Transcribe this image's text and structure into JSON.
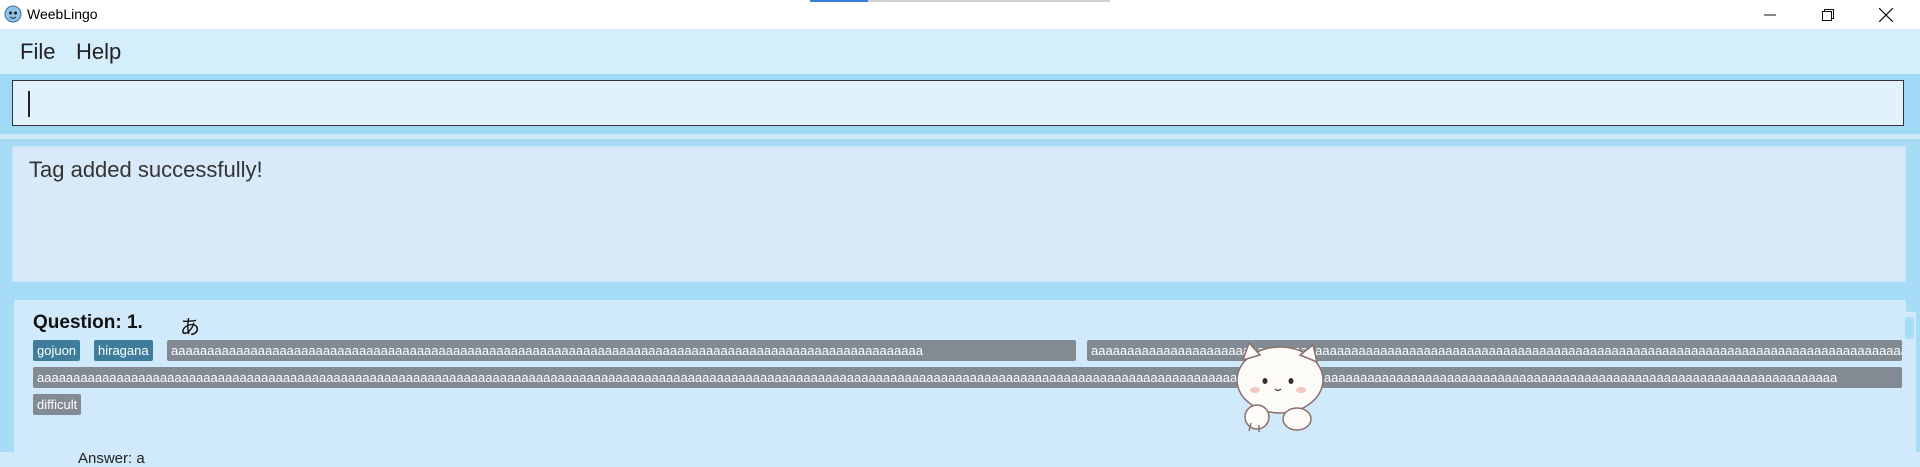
{
  "window": {
    "title": "WeebLingo"
  },
  "menu": {
    "items": [
      "File",
      "Help"
    ]
  },
  "command": {
    "value": ""
  },
  "result": {
    "message": "Tag added successfully!"
  },
  "question": {
    "label": "Question: 1.",
    "kana": "あ",
    "tags": [
      {
        "text": "gojuon",
        "kind": "category"
      },
      {
        "text": "hiragana",
        "kind": "category"
      },
      {
        "text": "aaaaaaaaaaaaaaaaaaaaaaaaaaaaaaaaaaaaaaaaaaaaaaaaaaaaaaaaaaaaaaaaaaaaaaaaaaaaaaaaaaaaaaaaaaaaaaaaaaaaaaaa",
        "kind": "user"
      },
      {
        "text": "aaaaaaaaaaaaaaaaaaaaaaaaaaaaaaaaaaaaaaaaaaaaaaaaaaaaaaaaaaaaaaaaaaaaaaaaaaaaaaaaaaaaaaaaaaaaaaaaaaaaaaaaaaaaaaaaaaaaaaaaaaaaaaaaaaaaaaaaaaaaaaaaaaaaaaaaaaaaaaaaaaaaaaaaaaaaaaaaaaaa",
        "kind": "user"
      },
      {
        "text": "aaaaaaaaaaaaaaaaaaaaaaaaaaaaaaaaaaaaaaaaaaaaaaaaaaaaaaaaaaaaaaaaaaaaaaaaaaaaaaaaaaaaaaaaaaaaaaaaaaaaaaaaaaaaaaaaaaaaaaaaaaaaaaaaaaaaaaaaaaaaaaaaaaaaaaaaaaaaaaaaaaaaaaaaaaaaaaaaaaaaaaaaaaaaaaaaaaaaaaaaaaaaaaaaaaaaaaaaaaaaaaaaaaaaaaaaaaaaaaaaaaaaaaaaa",
        "kind": "user"
      },
      {
        "text": "difficult",
        "kind": "user"
      }
    ],
    "answer": "Answer: a"
  },
  "colors": {
    "accent": "#9fd9f6",
    "category_tag": "#3e7e9c",
    "user_tag": "#828a93",
    "panel": "#d0e9fb"
  },
  "icons": {
    "app": "weeblingo-app-icon",
    "minimize": "minimize-icon",
    "maximize": "restore-icon",
    "close": "close-icon",
    "mascot": "cat-mascot"
  }
}
